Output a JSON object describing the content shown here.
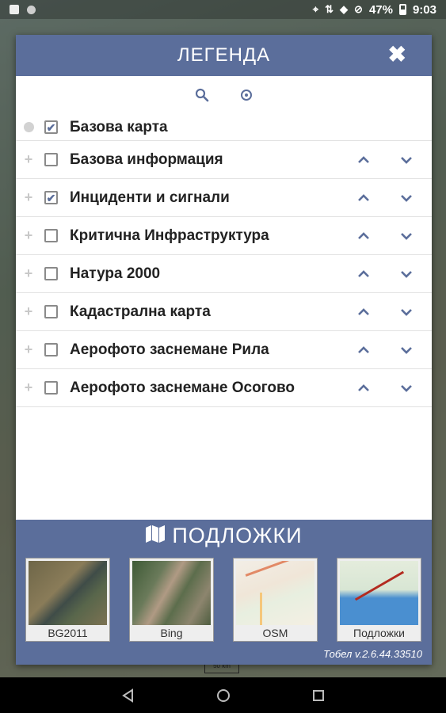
{
  "status_bar": {
    "battery": "47%",
    "time": "9:03"
  },
  "dialog": {
    "title": "ЛЕГЕНДА",
    "close_icon": "close-icon",
    "tools": [
      {
        "name": "search-icon"
      },
      {
        "name": "locate-icon"
      }
    ],
    "base_layer": {
      "label": "Базова карта",
      "checked": true
    },
    "layers": [
      {
        "label": "Базова информация",
        "checked": false
      },
      {
        "label": "Инциденти и сигнали",
        "checked": true
      },
      {
        "label": "Критична Инфраструктура",
        "checked": false
      },
      {
        "label": "Натура 2000",
        "checked": false
      },
      {
        "label": "Кадастрална карта",
        "checked": false
      },
      {
        "label": "Аерофото заснемане Рила",
        "checked": false
      },
      {
        "label": "Аерофото заснемане Осогово",
        "checked": false
      }
    ],
    "basemaps": {
      "title": "ПОДЛОЖКИ",
      "items": [
        {
          "label": "BG2011"
        },
        {
          "label": "Bing"
        },
        {
          "label": "OSM"
        },
        {
          "label": "Подложки"
        }
      ]
    },
    "version": "Тобел v.2.6.44.33510"
  },
  "map": {
    "scale_label": "50 km"
  },
  "colors": {
    "header": "#5b6e9b",
    "arrow": "#5b6e9b"
  }
}
